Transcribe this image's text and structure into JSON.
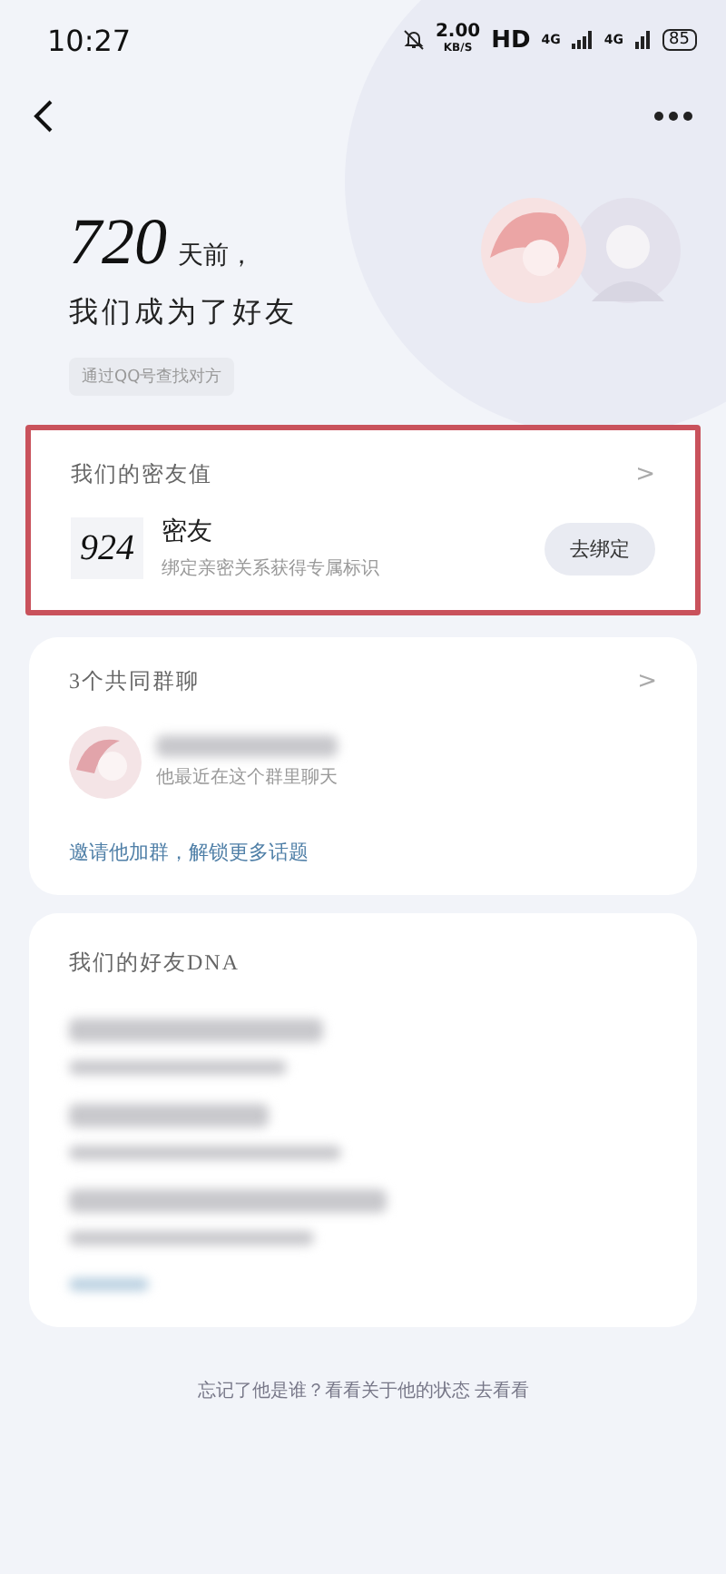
{
  "status_bar": {
    "time": "10:27",
    "speed": "2.00",
    "speed_unit": "KB/S",
    "hd": "HD",
    "network_1": "4G",
    "network_2": "4G",
    "battery": "85"
  },
  "header": {
    "days": "720",
    "days_suffix": "天前，",
    "subtitle": "我们成为了好友",
    "source": "通过QQ号查找对方"
  },
  "intimacy_card": {
    "highlighted": true,
    "title": "我们的密友值",
    "chevron": ">",
    "score": "924",
    "relation": "密友",
    "hint": "绑定亲密关系获得专属标识",
    "button": "去绑定"
  },
  "groups_card": {
    "title": "3个共同群聊",
    "chevron": ">",
    "group_hint": "他最近在这个群里聊天",
    "invite": "邀请他加群，解锁更多话题"
  },
  "dna_card": {
    "title": "我们的好友DNA"
  },
  "footer": "忘记了他是谁？看看关于他的状态 去看看"
}
